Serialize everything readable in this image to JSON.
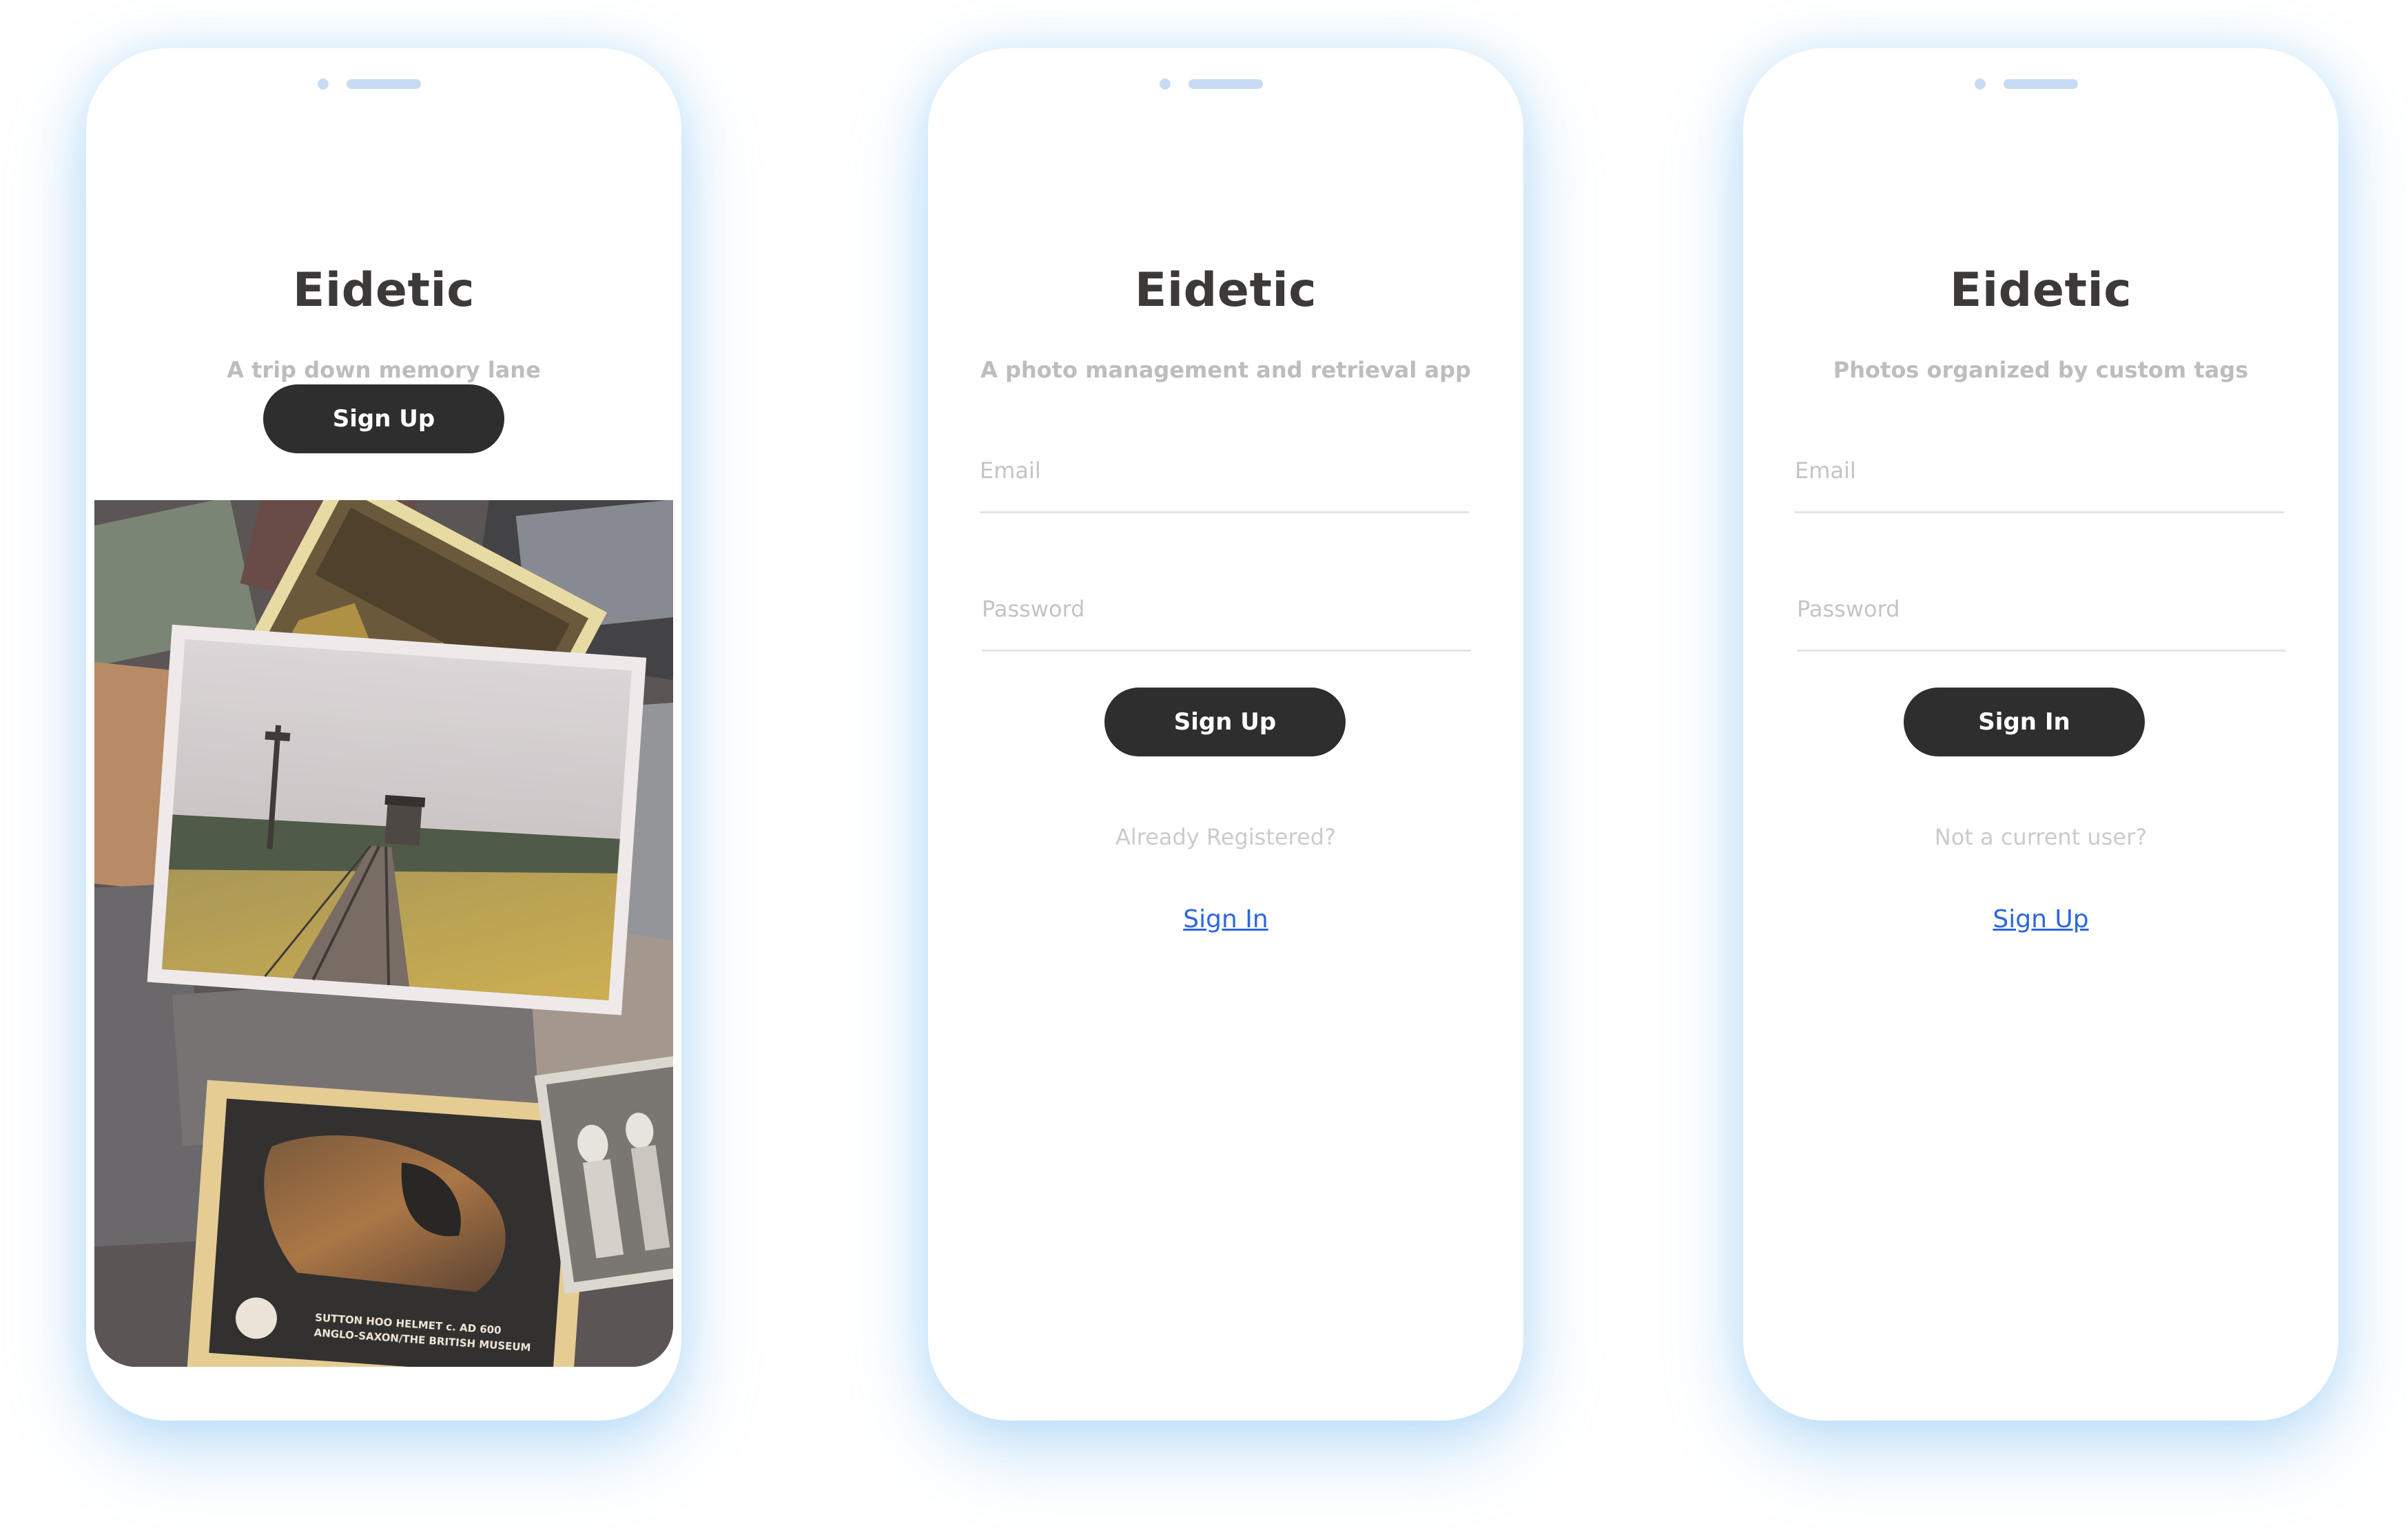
{
  "screens": [
    {
      "title": "Eidetic",
      "tagline": "A trip down memory lane",
      "primary_button": "Sign Up",
      "photo_caption_line1": "SUTTON HOO HELMET c. AD 600",
      "photo_caption_line2": "ANGLO-SAXON/THE BRITISH MUSEUM"
    },
    {
      "title": "Eidetic",
      "tagline": "A photo management and retrieval app",
      "email_placeholder": "Email",
      "password_placeholder": "Password",
      "primary_button": "Sign Up",
      "prompt": "Already Registered?",
      "link": "Sign In"
    },
    {
      "title": "Eidetic",
      "tagline": "Photos organized by custom tags",
      "email_placeholder": "Email",
      "password_placeholder": "Password",
      "primary_button": "Sign In",
      "prompt": "Not a current user?",
      "link": "Sign Up"
    }
  ],
  "colors": {
    "button_bg": "#2e2e2e",
    "title": "#3d3939",
    "tagline": "#bdbdbd",
    "link": "#2c66e0",
    "shadow": "#9fd0f5"
  }
}
